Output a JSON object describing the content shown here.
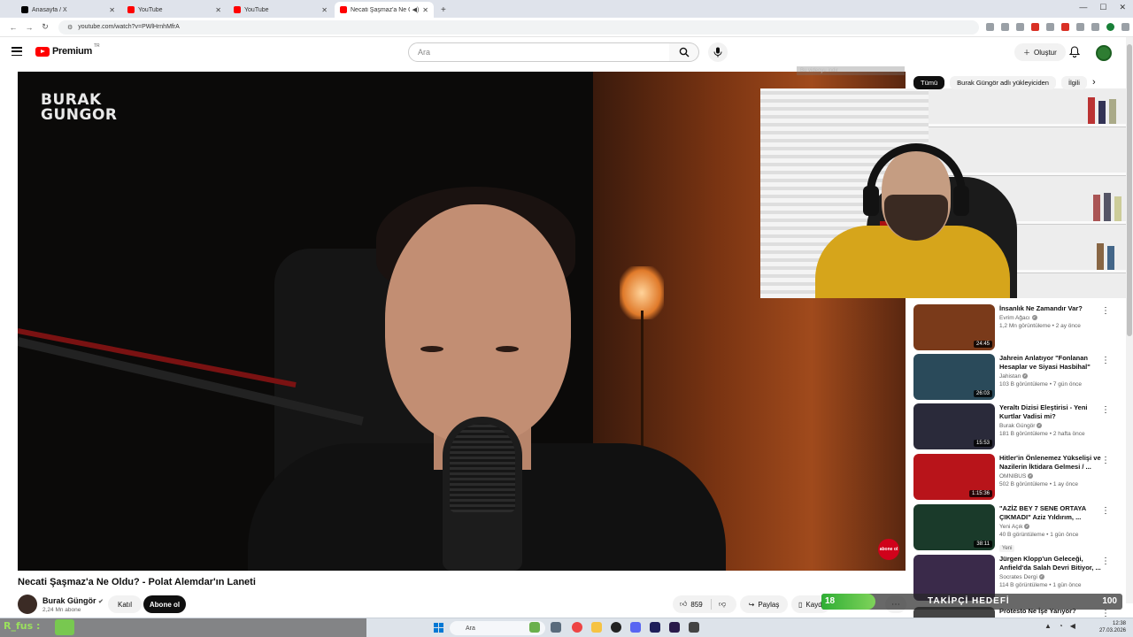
{
  "browser": {
    "tabs": [
      {
        "title": "Anasayfa / X",
        "favicon": "x-icon"
      },
      {
        "title": "YouTube",
        "favicon": "youtube-icon"
      },
      {
        "title": "YouTube",
        "favicon": "youtube-icon"
      },
      {
        "title": "Necati Şaşmaz'a Ne Oldu?",
        "favicon": "youtube-icon",
        "active": true
      }
    ],
    "new_tab": "+",
    "url": "youtube.com/watch?v=PWlHrnhMfrA"
  },
  "masthead": {
    "logo_text": "Premium",
    "country_code": "TR",
    "search_placeholder": "Ara",
    "create_label": "Oluştur"
  },
  "player": {
    "watermark_line1": "BURAK",
    "watermark_line2": "GUNGOR",
    "download_hint": "Bu videoyu indir",
    "abone_badge": "abone ol"
  },
  "video": {
    "title": "Necati Şaşmaz'a Ne Oldu? - Polat Alemdar'ın Laneti",
    "channel": "Burak Güngör",
    "subscribers": "2,24 Mn abone",
    "join_label": "Katıl",
    "subscribe_label": "Abone ol",
    "likes": "859",
    "share_label": "Paylaş",
    "save_label": "Kaydet"
  },
  "sidebar": {
    "chips": [
      "Tümü",
      "Burak Güngör adlı yükleyiciden",
      "İlgili"
    ],
    "recommendations": [
      {
        "title": "İnsanlık Ne Zamandır Var?",
        "channel": "Evrim Ağacı",
        "meta": "1,2 Mn görüntüleme • 2 ay önce",
        "duration": "24:45",
        "thumb_color": "#7a3a1a"
      },
      {
        "title": "Jahrein Anlatıyor \"Fonlanan Hesaplar ve Siyasi Hasbihal\"",
        "channel": "Jahistan",
        "meta": "103 B görüntüleme • 7 gün önce",
        "duration": "26:03",
        "thumb_color": "#2a4a5a"
      },
      {
        "title": "Yeraltı Dizisi Eleştirisi - Yeni Kurtlar Vadisi mi?",
        "channel": "Burak Güngör",
        "meta": "181 B görüntüleme • 2 hafta önce",
        "duration": "15:53",
        "thumb_color": "#2a2a3a"
      },
      {
        "title": "Hitler'in Önlenemez Yükselişi ve Nazilerin İktidara Gelmesi / ...",
        "channel": "OMNIBUS",
        "meta": "502 B görüntüleme • 1 ay önce",
        "duration": "1:15:36",
        "thumb_color": "#b8141a"
      },
      {
        "title": "\"AZİZ BEY 7 SENE ORTAYA ÇIKMADI\" Aziz Yıldırım, ...",
        "channel": "Yeni Açık",
        "meta": "40 B görüntüleme • 1 gün önce",
        "duration": "38:11",
        "thumb_color": "#1a3a2a",
        "badge": "Yeni"
      },
      {
        "title": "Jürgen Klopp'un Geleceği, Anfield'da Salah Devri Bitiyor, ...",
        "channel": "Socrates Dergi",
        "meta": "114 B görüntüleme • 1 gün önce",
        "duration": "",
        "thumb_color": "#3a2a4a"
      },
      {
        "title": "Protesto Ne İşe Yarıyor?",
        "channel": "",
        "meta": "",
        "duration": "",
        "thumb_color": "#444444"
      }
    ]
  },
  "follower_goal": {
    "current": "18",
    "label": "TAKİPÇİ HEDEFİ",
    "target": "100",
    "progress_fraction": 0.18
  },
  "stream_chat": {
    "username": "R_fus :"
  },
  "taskbar": {
    "search_placeholder": "Ara",
    "time": "12:38",
    "date": "27.03.2026"
  }
}
